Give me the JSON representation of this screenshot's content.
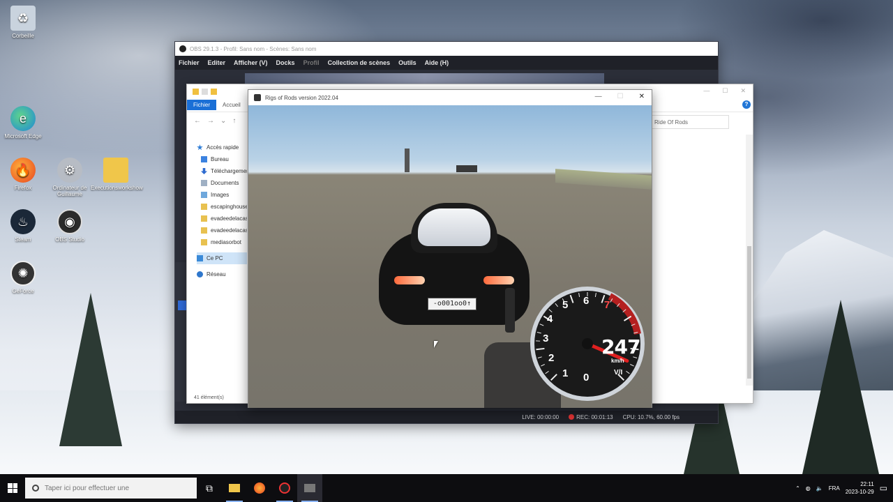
{
  "desktop": {
    "icons": [
      {
        "label": "Corbeille",
        "glyph": "recycle-bin-icon"
      },
      {
        "label": "Microsoft Edge",
        "glyph": "edge-icon"
      },
      {
        "label": "Firefox",
        "glyph": "firefox-icon"
      },
      {
        "label": "Ordinateur de Guillaume",
        "glyph": "gear-icon"
      },
      {
        "label": "Executionsworkshow",
        "glyph": "folder-icon"
      },
      {
        "label": "Steam",
        "glyph": "steam-icon"
      },
      {
        "label": "OBS Studio",
        "glyph": "obs-icon"
      },
      {
        "label": "GeForce",
        "glyph": "app-icon"
      }
    ]
  },
  "obs": {
    "title": "OBS 29.1.3 - Profil: Sans nom - Scènes: Sans nom",
    "menu": [
      "Fichier",
      "Editer",
      "Afficher (V)",
      "Docks",
      "Profil",
      "Collection de scènes",
      "Outils",
      "Aide (H)"
    ],
    "status": {
      "live": "LIVE: 00:00:00",
      "rec": "REC: 00:01:13",
      "cpu": "CPU: 10.7%, 60.00 fps"
    }
  },
  "explorer": {
    "ribbon": {
      "file": "Fichier",
      "home": "Accueil"
    },
    "address": "Ride Of Rods",
    "sidebar": [
      {
        "label": "Accès rapide",
        "icon": "star-icon"
      },
      {
        "label": "Bureau",
        "icon": "desktop-icon"
      },
      {
        "label": "Téléchargements",
        "icon": "download-icon"
      },
      {
        "label": "Documents",
        "icon": "document-icon"
      },
      {
        "label": "Images",
        "icon": "image-icon"
      },
      {
        "label": "escapinghouse",
        "icon": "folder-icon"
      },
      {
        "label": "evadeedelacas",
        "icon": "folder-icon"
      },
      {
        "label": "evadeedelacas",
        "icon": "folder-icon"
      },
      {
        "label": "mediasorbot",
        "icon": "folder-icon"
      },
      {
        "label": "Ce PC",
        "icon": "pc-icon"
      },
      {
        "label": "Réseau",
        "icon": "network-icon"
      }
    ],
    "status": "41 élément(s)"
  },
  "game": {
    "title": "Rigs of Rods version 2022.04",
    "plate": "-o001oo0↑",
    "speed": "247",
    "unit": "km/h",
    "gear": "V/I",
    "dial_numbers": [
      "0",
      "1",
      "2",
      "3",
      "4",
      "5",
      "6",
      "7"
    ],
    "needle_fraction": 0.92
  },
  "taskbar": {
    "search_placeholder": "Taper ici pour effectuer une",
    "time": "22:11",
    "date": "2023-10-29",
    "lang": "FRA"
  },
  "colors": {
    "accent": "#1a6fd6",
    "rec": "#dd3333",
    "needle": "#e02020"
  }
}
